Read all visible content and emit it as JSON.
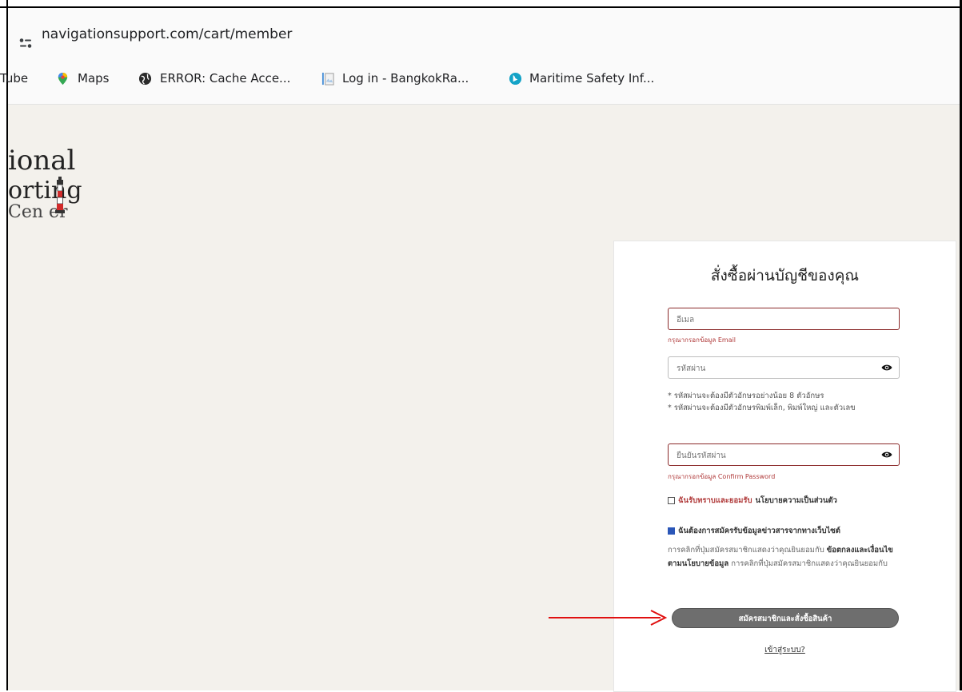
{
  "browser": {
    "url": "navigationsupport.com/cart/member",
    "bookmarks": [
      {
        "label": "Tube",
        "icon": "youtube-icon"
      },
      {
        "label": "Maps",
        "icon": "maps-pin-icon"
      },
      {
        "label": "ERROR: Cache Acce...",
        "icon": "globe-icon"
      },
      {
        "label": "Log in - BangkokRa...",
        "icon": "document-icon"
      },
      {
        "label": "Maritime Safety Inf...",
        "icon": "bing-icon"
      }
    ]
  },
  "logo": {
    "line1": "ional",
    "line2": "orting",
    "line3": "Cen er"
  },
  "form": {
    "title": "สั่งซื้อผ่านบัญชีของคุณ",
    "email_placeholder": "อีเมล",
    "email_error": "กรุณากรอกข้อมูล Email",
    "password_placeholder": "รหัสผ่าน",
    "password_hints": [
      "* รหัสผ่านจะต้องมีตัวอักษรอย่างน้อย 8 ตัวอักษร",
      "* รหัสผ่านจะต้องมีตัวอักษรพิมพ์เล็ก, พิมพ์ใหญ่ และตัวเลข"
    ],
    "confirm_placeholder": "ยืนยันรหัสผ่าน",
    "confirm_error": "กรุณากรอกข้อมูล Confirm Password",
    "privacy_accept_red": "ฉันรับทราบและยอมรับ",
    "privacy_accept_rest": "นโยบายความเป็นส่วนตัว",
    "privacy_checked": false,
    "newsletter_label": "ฉันต้องการสมัครรับข้อมูลข่าวสารจากทางเว็บไซต์",
    "newsletter_checked": true,
    "consent_part1": "การคลิกที่ปุ่มสมัครสมาชิกแสดงว่าคุณยินยอมกับ",
    "consent_bold": "ข้อตกลงและเงื่อนไขตามนโยบายข้อมูล",
    "consent_part2": "การคลิกที่ปุ่มสมัครสมาชิกแสดงว่าคุณยินยอมกับ",
    "submit_label": "สมัครสมาชิกและสั่งซื้อสินค้า",
    "login_link": "เข้าสู่ระบบ?"
  },
  "colors": {
    "error": "#8b2a2a",
    "button": "#6e6e6e",
    "arrow": "#e01010",
    "page_bg": "#f3f1ec"
  }
}
